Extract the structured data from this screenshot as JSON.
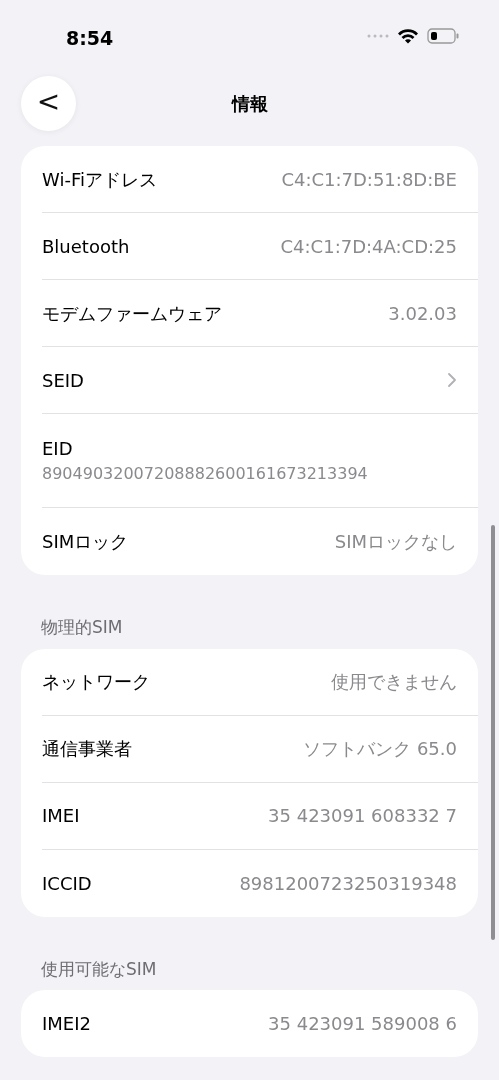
{
  "status_bar": {
    "time": "8:54"
  },
  "nav": {
    "title": "情報",
    "back": "<"
  },
  "sections": [
    {
      "rows": [
        {
          "kind": "value",
          "label": "Wi-Fiアドレス",
          "value": "C4:C1:7D:51:8D:BE"
        },
        {
          "kind": "value",
          "label": "Bluetooth",
          "value": "C4:C1:7D:4A:CD:25"
        },
        {
          "kind": "value",
          "label": "モデムファームウェア",
          "value": "3.02.03"
        },
        {
          "kind": "chevron",
          "label": "SEID"
        },
        {
          "kind": "stacked",
          "label": "EID",
          "value": "89049032007208882600161673213394"
        },
        {
          "kind": "value",
          "label": "SIMロック",
          "value": "SIMロックなし"
        }
      ]
    },
    {
      "header": "物理的SIM",
      "rows": [
        {
          "kind": "value",
          "label": "ネットワーク",
          "value": "使用できません"
        },
        {
          "kind": "value",
          "label": "通信事業者",
          "value": "ソフトバンク 65.0"
        },
        {
          "kind": "value",
          "label": "IMEI",
          "value": "35 423091 608332 7"
        },
        {
          "kind": "value",
          "label": "ICCID",
          "value": "8981200723250319348"
        }
      ]
    },
    {
      "header": "使用可能なSIM",
      "rows": [
        {
          "kind": "value",
          "label": "IMEI2",
          "value": "35 423091 589008 6"
        }
      ]
    }
  ]
}
